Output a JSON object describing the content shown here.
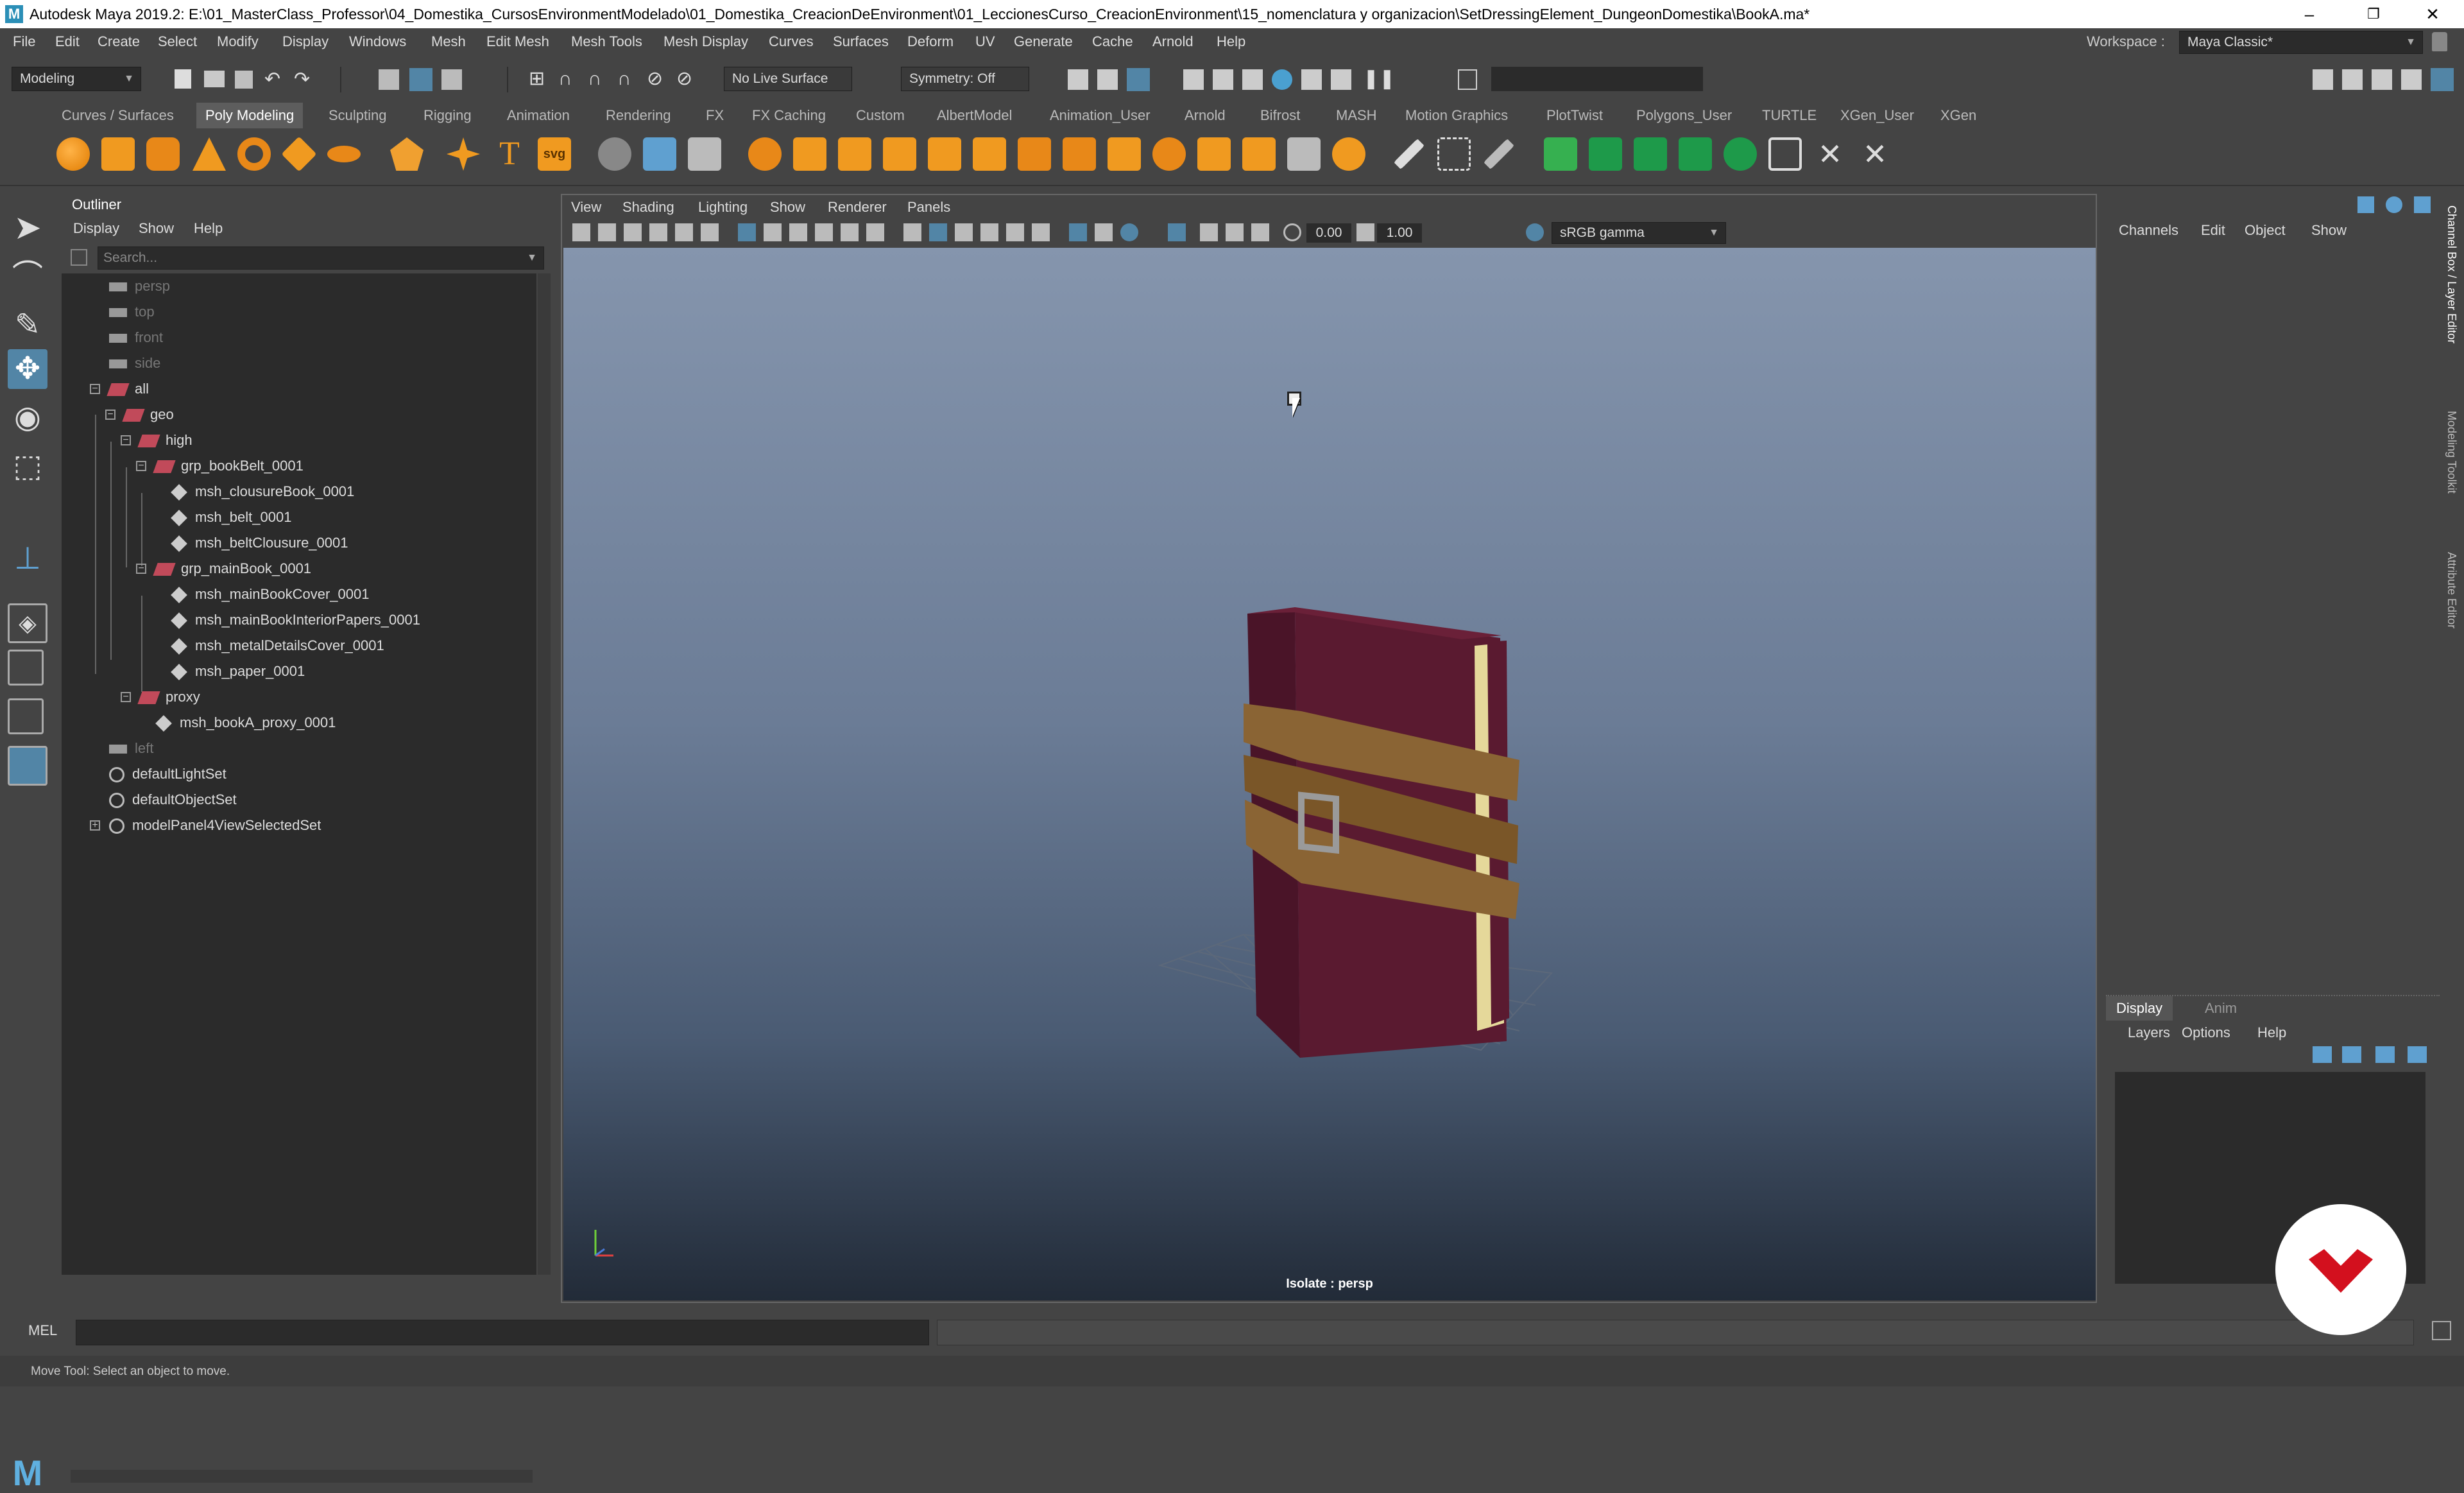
{
  "window": {
    "title": "Autodesk Maya 2019.2: E:\\01_MasterClass_Professor\\04_Domestika_CursosEnvironmentModelado\\01_Domestika_CreacionDeEnvironment\\01_LeccionesCurso_CreacionEnvironment\\15_nomenclatura y organizacion\\SetDressingElement_DungeonDomestika\\BookA.ma*",
    "logo": "M",
    "minimize": "–",
    "restore": "❐",
    "close": "✕"
  },
  "menubar": {
    "items": [
      "File",
      "Edit",
      "Create",
      "Select",
      "Modify",
      "Display",
      "Windows",
      "Mesh",
      "Edit Mesh",
      "Mesh Tools",
      "Mesh Display",
      "Curves",
      "Surfaces",
      "Deform",
      "UV",
      "Generate",
      "Cache",
      "Arnold",
      "Help"
    ],
    "workspace_label": "Workspace :",
    "workspace_value": "Maya Classic*"
  },
  "statusline": {
    "menuset": "Modeling",
    "live_surface": "No Live Surface",
    "symmetry": "Symmetry: Off"
  },
  "shelf": {
    "tabs": [
      "Curves / Surfaces",
      "Poly Modeling",
      "Sculpting",
      "Rigging",
      "Animation",
      "Rendering",
      "FX",
      "FX Caching",
      "Custom",
      "AlbertModel",
      "Animation_User",
      "Arnold",
      "Bifrost",
      "MASH",
      "Motion Graphics",
      "PlotTwist",
      "Polygons_User",
      "TURTLE",
      "XGen_User",
      "XGen"
    ],
    "active_tab": "Poly Modeling",
    "icons": [
      "sphere-icon",
      "cube-icon",
      "cylinder-icon",
      "cone-icon",
      "torus-icon",
      "plane-icon",
      "disc-icon",
      "platonic-icon",
      "superellipse-icon",
      "text-icon",
      "svg-icon"
    ]
  },
  "outliner": {
    "title": "Outliner",
    "menu": [
      "Display",
      "Show",
      "Help"
    ],
    "search_placeholder": "Search...",
    "items": [
      {
        "label": "persp",
        "kind": "camera",
        "dim": true
      },
      {
        "label": "top",
        "kind": "camera",
        "dim": true
      },
      {
        "label": "front",
        "kind": "camera",
        "dim": true
      },
      {
        "label": "side",
        "kind": "camera",
        "dim": true
      },
      {
        "label": "all",
        "kind": "group",
        "dim": false
      },
      {
        "label": "geo",
        "kind": "group",
        "dim": false
      },
      {
        "label": "high",
        "kind": "group",
        "dim": false
      },
      {
        "label": "grp_bookBelt_0001",
        "kind": "group",
        "dim": false
      },
      {
        "label": "msh_clousureBook_0001",
        "kind": "mesh",
        "dim": false
      },
      {
        "label": "msh_belt_0001",
        "kind": "mesh",
        "dim": false
      },
      {
        "label": "msh_beltClousure_0001",
        "kind": "mesh",
        "dim": false
      },
      {
        "label": "grp_mainBook_0001",
        "kind": "group",
        "dim": false
      },
      {
        "label": "msh_mainBookCover_0001",
        "kind": "mesh",
        "dim": false
      },
      {
        "label": "msh_mainBookInteriorPapers_0001",
        "kind": "mesh",
        "dim": false
      },
      {
        "label": "msh_metalDetailsCover_0001",
        "kind": "mesh",
        "dim": false
      },
      {
        "label": "msh_paper_0001",
        "kind": "mesh",
        "dim": false
      },
      {
        "label": "proxy",
        "kind": "group",
        "dim": false
      },
      {
        "label": "msh_bookA_proxy_0001",
        "kind": "mesh",
        "dim": false
      },
      {
        "label": "left",
        "kind": "camera",
        "dim": true
      },
      {
        "label": "defaultLightSet",
        "kind": "set",
        "dim": false
      },
      {
        "label": "defaultObjectSet",
        "kind": "set",
        "dim": false
      },
      {
        "label": "modelPanel4ViewSelectedSet",
        "kind": "set",
        "dim": false
      }
    ]
  },
  "viewport": {
    "menu": [
      "View",
      "Shading",
      "Lighting",
      "Show",
      "Renderer",
      "Panels"
    ],
    "exposure": "0.00",
    "gamma": "1.00",
    "color_space": "sRGB gamma",
    "isolate_label": "Isolate : persp"
  },
  "channelbox": {
    "menu": [
      "Channels",
      "Edit",
      "Object",
      "Show"
    ],
    "side_tabs": [
      "Channel Box / Layer Editor",
      "Modeling Toolkit",
      "Attribute Editor"
    ]
  },
  "layereditor": {
    "tabs": [
      "Display",
      "Anim"
    ],
    "menu": [
      "Layers",
      "Options",
      "Help"
    ]
  },
  "commandline": {
    "label": "MEL"
  },
  "helpline": {
    "text": "Move Tool: Select an object to move."
  },
  "colors": {
    "accent": "#5285a6",
    "book_cover": "#5a1a30",
    "belt": "#8a6434",
    "paper": "#e5d89a",
    "badge_red": "#d3101e"
  }
}
